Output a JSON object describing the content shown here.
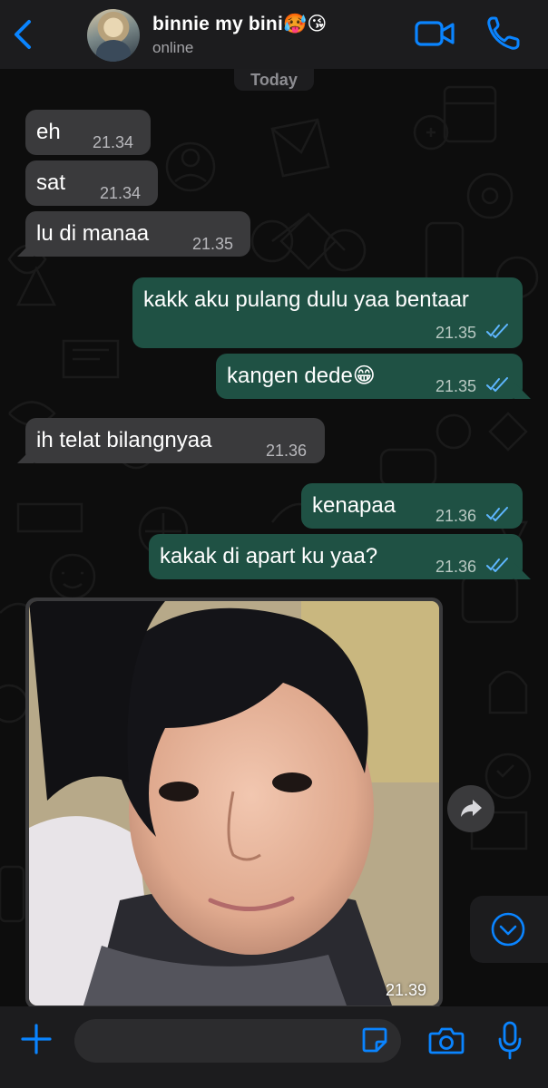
{
  "header": {
    "contact_name": "binnie my bini🥵😘",
    "status": "online"
  },
  "chat": {
    "date_label": "Today",
    "messages": [
      {
        "direction": "incoming",
        "text": "eh",
        "time": "21.34"
      },
      {
        "direction": "incoming",
        "text": "sat",
        "time": "21.34"
      },
      {
        "direction": "incoming",
        "text": "lu di manaa",
        "time": "21.35"
      },
      {
        "direction": "outgoing",
        "text": "kakk aku pulang dulu yaa bentaar",
        "time": "21.35",
        "status": "read"
      },
      {
        "direction": "outgoing",
        "text": "kangen dede😁",
        "time": "21.35",
        "status": "read"
      },
      {
        "direction": "incoming",
        "text": "ih telat bilangnyaa",
        "time": "21.36"
      },
      {
        "direction": "outgoing",
        "text": "kenapaa",
        "time": "21.36",
        "status": "read"
      },
      {
        "direction": "outgoing",
        "text": "kakak di apart ku yaa?",
        "time": "21.36",
        "status": "read"
      }
    ],
    "photo_message": {
      "direction": "incoming",
      "time": "21.39"
    }
  },
  "input": {
    "value": "",
    "placeholder": ""
  },
  "colors": {
    "accent": "#0a84ff",
    "header_bg": "#1c1c1e",
    "incoming_bubble": "#3a3a3c",
    "outgoing_bubble": "#1f5144",
    "read_ticks": "#5eb6ff"
  },
  "icons": [
    "chevron-left-icon",
    "video-camera-icon",
    "phone-icon",
    "forward-icon",
    "chevron-down-icon",
    "plus-icon",
    "sticker-icon",
    "camera-icon",
    "microphone-icon"
  ]
}
